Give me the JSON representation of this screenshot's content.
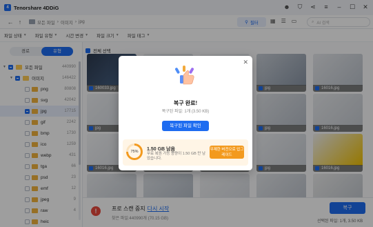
{
  "app": {
    "title": "Tenorshare 4DDiG",
    "logo_text": "4"
  },
  "nav": {
    "breadcrumb": [
      "모든 파일",
      "이미지",
      "jpg"
    ],
    "filter_label": "필터",
    "search_placeholder": "AI 검색"
  },
  "filters": [
    "파일 상태",
    "파일 유형",
    "시간 변경",
    "파일 크기",
    "파일 태그"
  ],
  "sidebar": {
    "toggle": [
      "경로",
      "유형"
    ],
    "tree": [
      {
        "label": "모든 파일",
        "count": "440990"
      },
      {
        "label": "이미지",
        "count": "146422"
      },
      {
        "label": "png",
        "count": "80808"
      },
      {
        "label": "svg",
        "count": "42042"
      },
      {
        "label": "jpg",
        "count": "17715"
      },
      {
        "label": "gif",
        "count": "2242"
      },
      {
        "label": "bmp",
        "count": "1730"
      },
      {
        "label": "ico",
        "count": "1259"
      },
      {
        "label": "webp",
        "count": "431"
      },
      {
        "label": "tga",
        "count": "66"
      },
      {
        "label": "psd",
        "count": "23"
      },
      {
        "label": "emf",
        "count": "12"
      },
      {
        "label": "jpeg",
        "count": "9"
      },
      {
        "label": "raw",
        "count": "4"
      },
      {
        "label": "heic",
        "count": ""
      }
    ]
  },
  "content": {
    "select_all": "전체 선택",
    "thumbnails": [
      "160033.jpg",
      "jpg",
      "jpg",
      "jpg",
      "16016.jpg",
      "jpg",
      "jpg",
      "jpg",
      "jpg",
      "16016.jpg",
      "16016.jpg",
      "jpg",
      "jpg",
      "jpg",
      "16016.jpg",
      "16016.jpg",
      "jpg",
      "jpg",
      "jpg",
      "16016.jpg"
    ]
  },
  "bottom": {
    "stop_text": "프로 스캔 중지",
    "restart": "다시 시작",
    "found": "찾은 파일:440990개 (70.15 GB)",
    "recover": "복구",
    "selected": "선택된 파일: 1개, 3.50 KB"
  },
  "modal": {
    "title": "복구 완료!",
    "subtitle": "복구된 파일: 1개 (3.50 KB)",
    "view_button": "복구된 파일 확인",
    "promo": {
      "percent": "75%",
      "title": "1.50 GB 남음",
      "desc": "무료 복원 가능 용량이 1.50 GB 만 남았습니다.",
      "upgrade": "무제한 버전으로 업그레이드"
    }
  }
}
